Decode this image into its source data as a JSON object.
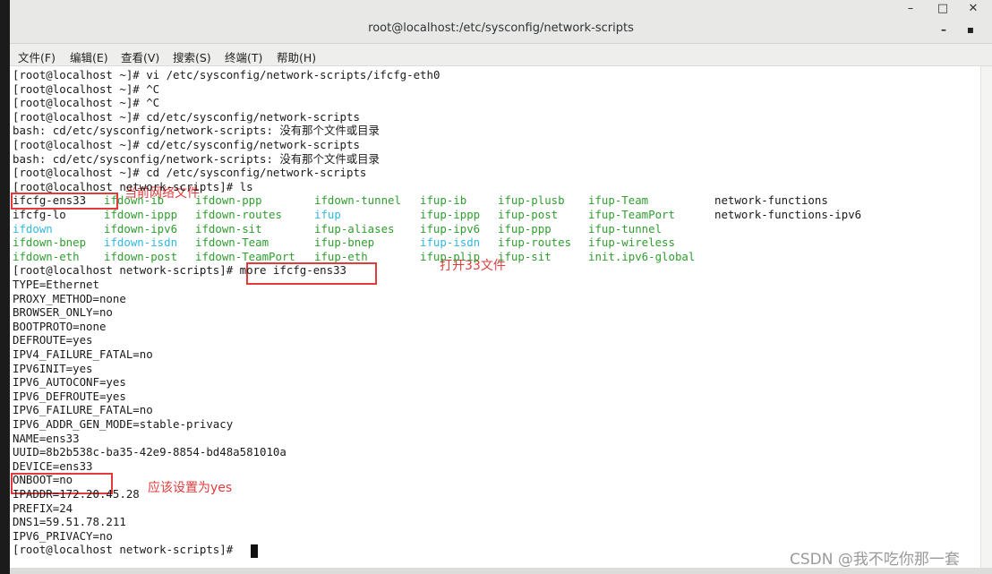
{
  "window": {
    "title": "root@localhost:/etc/sysconfig/network-scripts",
    "controls": {
      "minimize": "–",
      "maximize": "□",
      "close": "✕"
    },
    "terminal_controls": {
      "minimize": "–",
      "menu": "▪"
    }
  },
  "menu": [
    "文件(F)",
    "编辑(E)",
    "查看(V)",
    "搜索(S)",
    "终端(T)",
    "帮助(H)"
  ],
  "terminal": {
    "lines_before": [
      "[root@localhost ~]# vi /etc/sysconfig/network-scripts/ifcfg-eth0",
      "[root@localhost ~]# ^C",
      "[root@localhost ~]# ^C",
      "[root@localhost ~]# cd/etc/sysconfig/network-scripts",
      "bash: cd/etc/sysconfig/network-scripts: 没有那个文件或目录",
      "[root@localhost ~]# cd/etc/sysconfig/network-scripts",
      "bash: cd/etc/sysconfig/network-scripts: 没有那个文件或目录",
      "[root@localhost ~]# cd /etc/sysconfig/network-scripts",
      "[root@localhost network-scripts]# ls"
    ],
    "ls_rows": [
      [
        {
          "name": "ifcfg-ens33",
          "kind": "plain"
        },
        {
          "name": "ifdown-ib",
          "kind": "script"
        },
        {
          "name": "ifdown-ppp",
          "kind": "script"
        },
        {
          "name": "ifdown-tunnel",
          "kind": "script"
        },
        {
          "name": "ifup-ib",
          "kind": "script"
        },
        {
          "name": "ifup-plusb",
          "kind": "script"
        },
        {
          "name": "ifup-Team",
          "kind": "script"
        },
        {
          "name": "network-functions",
          "kind": "plain"
        }
      ],
      [
        {
          "name": "ifcfg-lo",
          "kind": "plain"
        },
        {
          "name": "ifdown-ippp",
          "kind": "script"
        },
        {
          "name": "ifdown-routes",
          "kind": "script"
        },
        {
          "name": "ifup",
          "kind": "link"
        },
        {
          "name": "ifup-ippp",
          "kind": "script"
        },
        {
          "name": "ifup-post",
          "kind": "script"
        },
        {
          "name": "ifup-TeamPort",
          "kind": "script"
        },
        {
          "name": "network-functions-ipv6",
          "kind": "plain"
        }
      ],
      [
        {
          "name": "ifdown",
          "kind": "link"
        },
        {
          "name": "ifdown-ipv6",
          "kind": "script"
        },
        {
          "name": "ifdown-sit",
          "kind": "script"
        },
        {
          "name": "ifup-aliases",
          "kind": "script"
        },
        {
          "name": "ifup-ipv6",
          "kind": "script"
        },
        {
          "name": "ifup-ppp",
          "kind": "script"
        },
        {
          "name": "ifup-tunnel",
          "kind": "script"
        },
        {
          "name": "",
          "kind": "plain"
        }
      ],
      [
        {
          "name": "ifdown-bnep",
          "kind": "script"
        },
        {
          "name": "ifdown-isdn",
          "kind": "link"
        },
        {
          "name": "ifdown-Team",
          "kind": "script"
        },
        {
          "name": "ifup-bnep",
          "kind": "script"
        },
        {
          "name": "ifup-isdn",
          "kind": "link"
        },
        {
          "name": "ifup-routes",
          "kind": "script"
        },
        {
          "name": "ifup-wireless",
          "kind": "script"
        },
        {
          "name": "",
          "kind": "plain"
        }
      ],
      [
        {
          "name": "ifdown-eth",
          "kind": "script"
        },
        {
          "name": "ifdown-post",
          "kind": "script"
        },
        {
          "name": "ifdown-TeamPort",
          "kind": "script"
        },
        {
          "name": "ifup-eth",
          "kind": "script"
        },
        {
          "name": "ifup-plip",
          "kind": "script"
        },
        {
          "name": "ifup-sit",
          "kind": "script"
        },
        {
          "name": "init.ipv6-global",
          "kind": "script"
        },
        {
          "name": "",
          "kind": "plain"
        }
      ]
    ],
    "lines_after": [
      "[root@localhost network-scripts]# more ifcfg-ens33",
      "TYPE=Ethernet",
      "PROXY_METHOD=none",
      "BROWSER_ONLY=no",
      "BOOTPROTO=none",
      "DEFROUTE=yes",
      "IPV4_FAILURE_FATAL=no",
      "IPV6INIT=yes",
      "IPV6_AUTOCONF=yes",
      "IPV6_DEFROUTE=yes",
      "IPV6_FAILURE_FATAL=no",
      "IPV6_ADDR_GEN_MODE=stable-privacy",
      "NAME=ens33",
      "UUID=8b2b538c-ba35-42e9-8854-bd48a581010a",
      "DEVICE=ens33",
      "ONBOOT=no",
      "IPADDR=172.20.45.28",
      "PREFIX=24",
      "DNS1=59.51.78.211",
      "IPV6_PRIVACY=no",
      "[root@localhost network-scripts]# "
    ]
  },
  "annotations": {
    "current_file": "当前网络文件",
    "open_file": "打开33文件",
    "set_yes": "应该设置为yes"
  },
  "colors": {
    "annotation": "#e23b3b",
    "script": "#2f9e2f",
    "link": "#2fb8e0"
  },
  "watermark": "CSDN @我不吃你那一套"
}
